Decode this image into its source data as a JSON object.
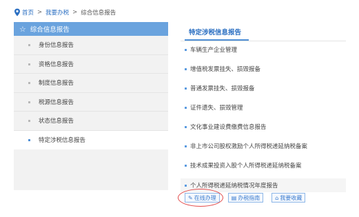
{
  "breadcrumb": {
    "home": "首页",
    "separator": ">",
    "level1": "我要办税",
    "level2": "综合信息报告"
  },
  "sidebar": {
    "title": "综合信息报告",
    "items": [
      {
        "label": "身份信息报告"
      },
      {
        "label": "资格信息报告"
      },
      {
        "label": "制度信息报告"
      },
      {
        "label": "税源信息报告"
      },
      {
        "label": "状态信息报告"
      },
      {
        "label": "特定涉税信息报告"
      }
    ]
  },
  "main": {
    "title": "特定涉税信息报告",
    "items": [
      {
        "label": "车辆生产企业管理"
      },
      {
        "label": "增值税发票挂失、损毁报备"
      },
      {
        "label": "普通发票挂失、损毁报备"
      },
      {
        "label": "证件遗失、损毁管理"
      },
      {
        "label": "文化事业建设费缴费信息报告"
      },
      {
        "label": "非上市公司股权激励个人所得税递延纳税备案"
      },
      {
        "label": "技术成果投资入股个人所得税递延纳税备案"
      },
      {
        "label": "个人所得税递延纳税情况年度报告"
      }
    ],
    "actions": {
      "online": "在线办理",
      "guide": "办税指南",
      "favorite": "我要收藏"
    }
  },
  "colors": {
    "accent": "#2b6fc2",
    "sidebar_header": "#6aa3de",
    "highlight_circle": "#e24a4a"
  }
}
